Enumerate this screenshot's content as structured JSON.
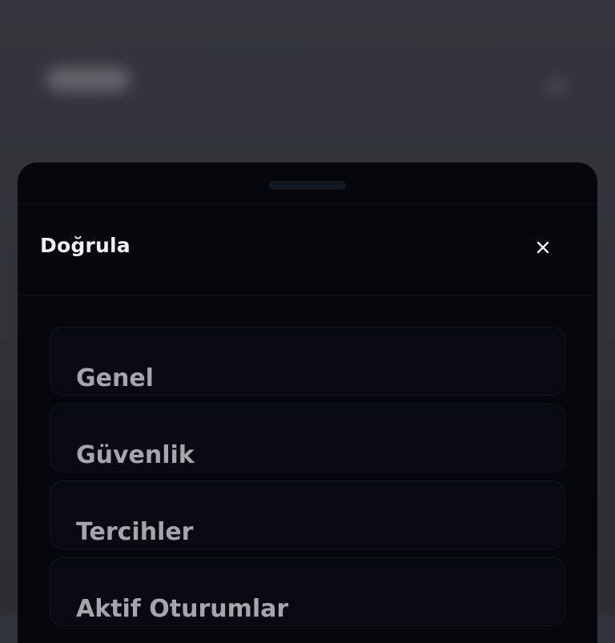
{
  "sheet": {
    "title": "Doğrula",
    "close_icon": "close-icon"
  },
  "menu": {
    "items": [
      {
        "label": "Genel"
      },
      {
        "label": "Güvenlik"
      },
      {
        "label": "Tercihler"
      },
      {
        "label": "Aktif Oturumlar"
      }
    ]
  },
  "colors": {
    "backdrop": "#31333a",
    "sheet": "#05070d",
    "title": "#eef0f4",
    "item_label": "#a4a6ab"
  }
}
